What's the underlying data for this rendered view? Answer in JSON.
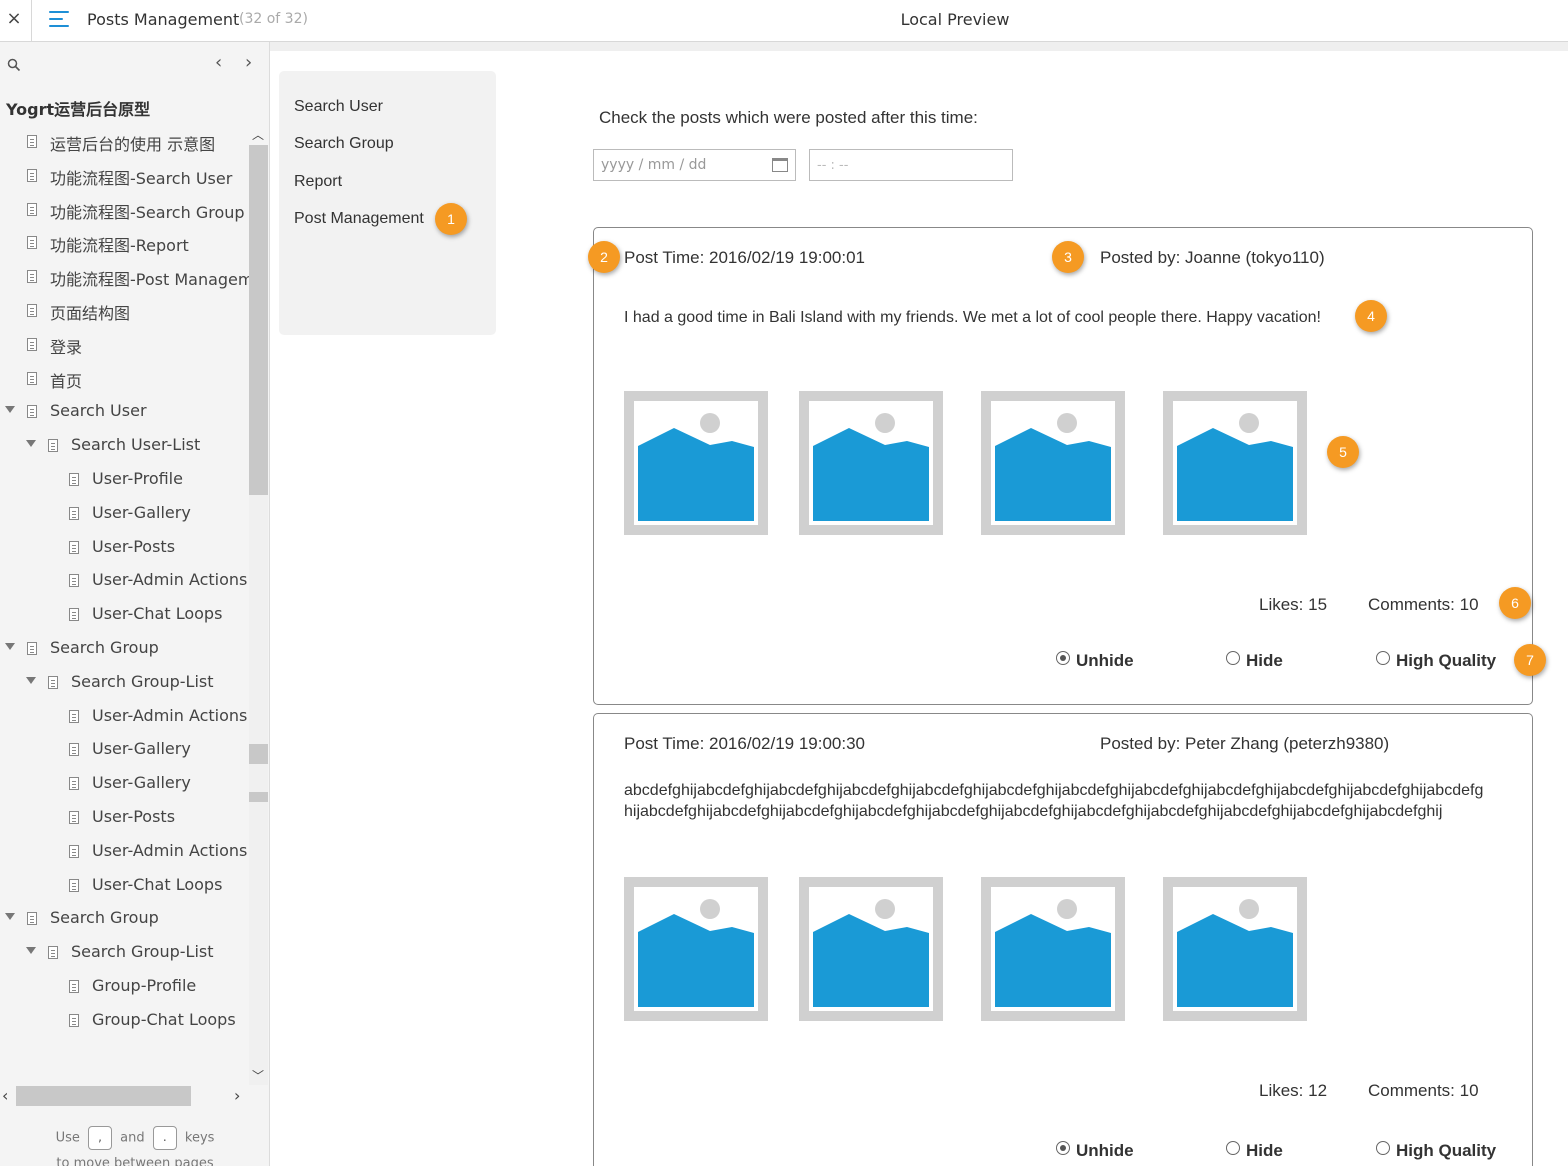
{
  "topbar": {
    "close": "×",
    "page_title": "Posts Management",
    "page_count": "(32 of 32)",
    "center_title": "Local Preview"
  },
  "sidebar": {
    "project": "Yogrt运营后台原型",
    "items": [
      {
        "label": "运营后台的使用 示意图",
        "level": 1,
        "caret": false
      },
      {
        "label": "功能流程图-Search User",
        "level": 1,
        "caret": false
      },
      {
        "label": "功能流程图-Search Group",
        "level": 1,
        "caret": false
      },
      {
        "label": "功能流程图-Report",
        "level": 1,
        "caret": false
      },
      {
        "label": "功能流程图-Post Managem",
        "level": 1,
        "caret": false
      },
      {
        "label": "页面结构图",
        "level": 1,
        "caret": false
      },
      {
        "label": "登录",
        "level": 1,
        "caret": false
      },
      {
        "label": "首页",
        "level": 1,
        "caret": false
      },
      {
        "label": "Search User",
        "level": 1,
        "caret": true
      },
      {
        "label": "Search User-List",
        "level": 2,
        "caret": true
      },
      {
        "label": "User-Profile",
        "level": 3,
        "caret": false
      },
      {
        "label": "User-Gallery",
        "level": 3,
        "caret": false
      },
      {
        "label": "User-Posts",
        "level": 3,
        "caret": false
      },
      {
        "label": "User-Admin Actions",
        "level": 3,
        "caret": false
      },
      {
        "label": "User-Chat Loops",
        "level": 3,
        "caret": false
      },
      {
        "label": "Search Group",
        "level": 1,
        "caret": true
      },
      {
        "label": "Search Group-List",
        "level": 2,
        "caret": true
      },
      {
        "label": "User-Admin Actions",
        "level": 3,
        "caret": false
      },
      {
        "label": "User-Gallery",
        "level": 3,
        "caret": false
      },
      {
        "label": "User-Gallery",
        "level": 3,
        "caret": false
      },
      {
        "label": "User-Posts",
        "level": 3,
        "caret": false
      },
      {
        "label": "User-Admin Actions",
        "level": 3,
        "caret": false
      },
      {
        "label": "User-Chat Loops",
        "level": 3,
        "caret": false
      },
      {
        "label": "Search Group",
        "level": 1,
        "caret": true
      },
      {
        "label": "Search Group-List",
        "level": 2,
        "caret": true
      },
      {
        "label": "Group-Profile",
        "level": 3,
        "caret": false
      },
      {
        "label": "Group-Chat Loops",
        "level": 3,
        "caret": false
      }
    ],
    "hint_use": "Use",
    "hint_and": "and",
    "hint_keys": "keys",
    "key_prev": ",",
    "key_next": ".",
    "hint_line2": "to move between pages"
  },
  "nav": {
    "items": [
      "Search User",
      "Search Group",
      "Report",
      "Post Management"
    ]
  },
  "filter": {
    "label": "Check the posts which were posted after this time:",
    "date_placeholder": "yyyy / mm / dd",
    "time_placeholder": "-- : --"
  },
  "badges": [
    "1",
    "2",
    "3",
    "4",
    "5",
    "6",
    "7"
  ],
  "posts": [
    {
      "time": "Post Time: 2016/02/19 19:00:01",
      "by": "Posted by: Joanne (tokyo110)",
      "content": "I had a good time in Bali Island with my friends. We met a lot of cool people there. Happy vacation!",
      "likes": "Likes: 15",
      "comments": "Comments: 10",
      "status": "Unhide"
    },
    {
      "time": "Post Time: 2016/02/19 19:00:30",
      "by": "Posted by: Peter Zhang (peterzh9380)",
      "content": "abcdefghijabcdefghijabcdefghijabcdefghijabcdefghijabcdefghijabcdefghijabcdefghijabcdefghijabcdefghijabcdefghijabcdefghijabcdefghijabcdefghijabcdefghijabcdefghijabcdefghijabcdefghijabcdefghijabcdefghijabcdefghijabcdefghijabcdefghij",
      "likes": "Likes: 12",
      "comments": "Comments: 10",
      "status": "Unhide"
    }
  ],
  "radio_labels": {
    "unhide": "Unhide",
    "hide": "Hide",
    "hq": "High Quality"
  },
  "colors": {
    "badge": "#f59a23",
    "image_fill": "#1a9ad6",
    "image_frame": "#d0d0d0",
    "menu_icon": "#1e8fd6"
  },
  "icons": {
    "close": "close-icon",
    "menu": "hamburger-icon",
    "search": "search-icon",
    "calendar": "calendar-icon",
    "image": "image-placeholder-icon"
  }
}
